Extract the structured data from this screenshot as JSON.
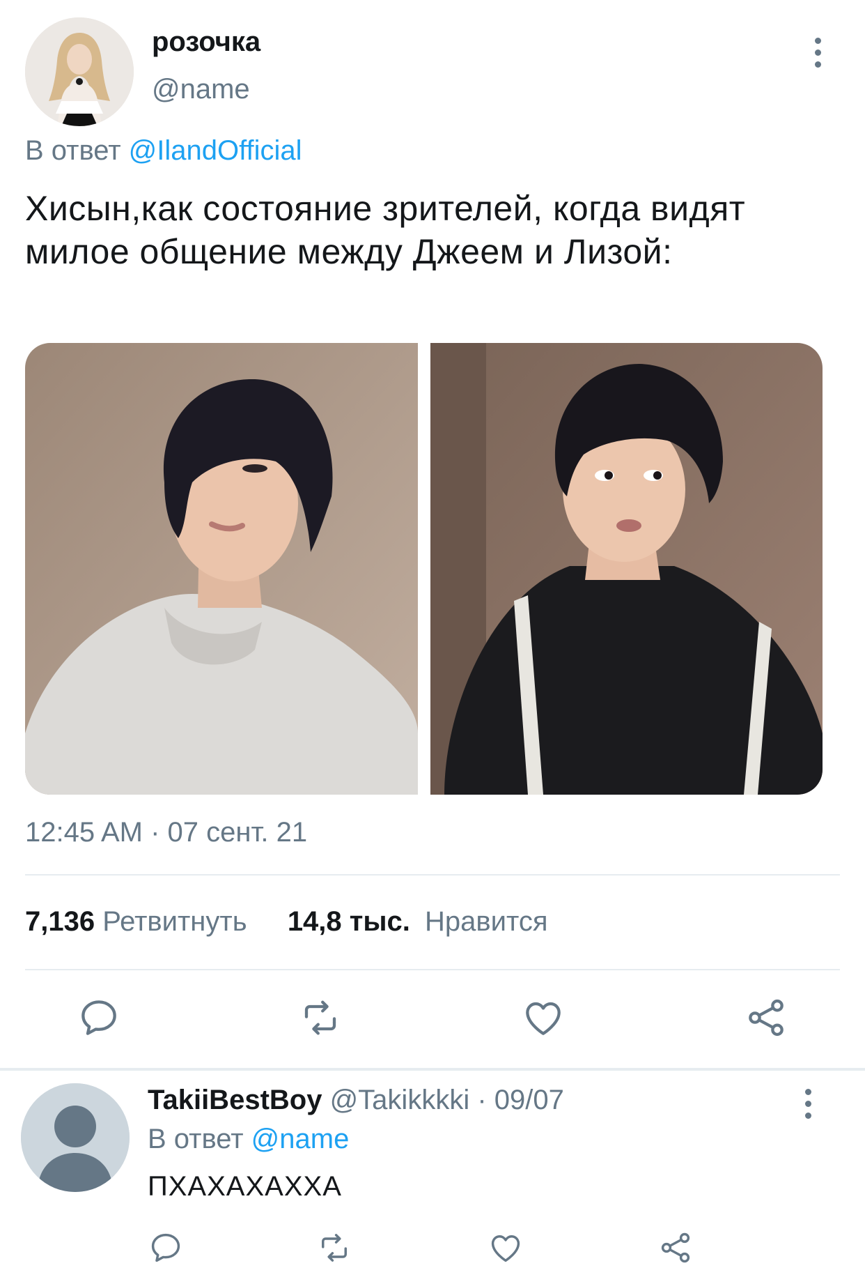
{
  "tweet": {
    "display_name": "розочка",
    "handle": "@name",
    "reply_prefix": "В ответ",
    "reply_mention": "@IlandOfficial",
    "text": "Хисын,как состояние зрителей, когда видят милое общение между Джеем и Лизой:",
    "timestamp": "12:45 AM · 07 сент. 21",
    "retweets_count": "7,136",
    "retweets_label": "Ретвитнуть",
    "likes_count": "14,8 тыс.",
    "likes_label": "Нравится",
    "actions": [
      "reply-icon",
      "retweet-icon",
      "like-icon",
      "share-icon"
    ],
    "media": [
      "photo-left",
      "photo-right"
    ]
  },
  "reply": {
    "display_name": "TakiiBestBoy",
    "handle_date": "@Takikkkki · 09/07",
    "reply_prefix": "В ответ",
    "reply_mention": "@name",
    "text": "ПХАХАХАХХА",
    "actions": [
      "reply-icon",
      "retweet-icon",
      "like-icon",
      "share-icon"
    ]
  },
  "colors": {
    "accent": "#1da1f2",
    "text_primary": "#14171a",
    "text_secondary": "#657786",
    "divider": "#e6ecf0"
  }
}
